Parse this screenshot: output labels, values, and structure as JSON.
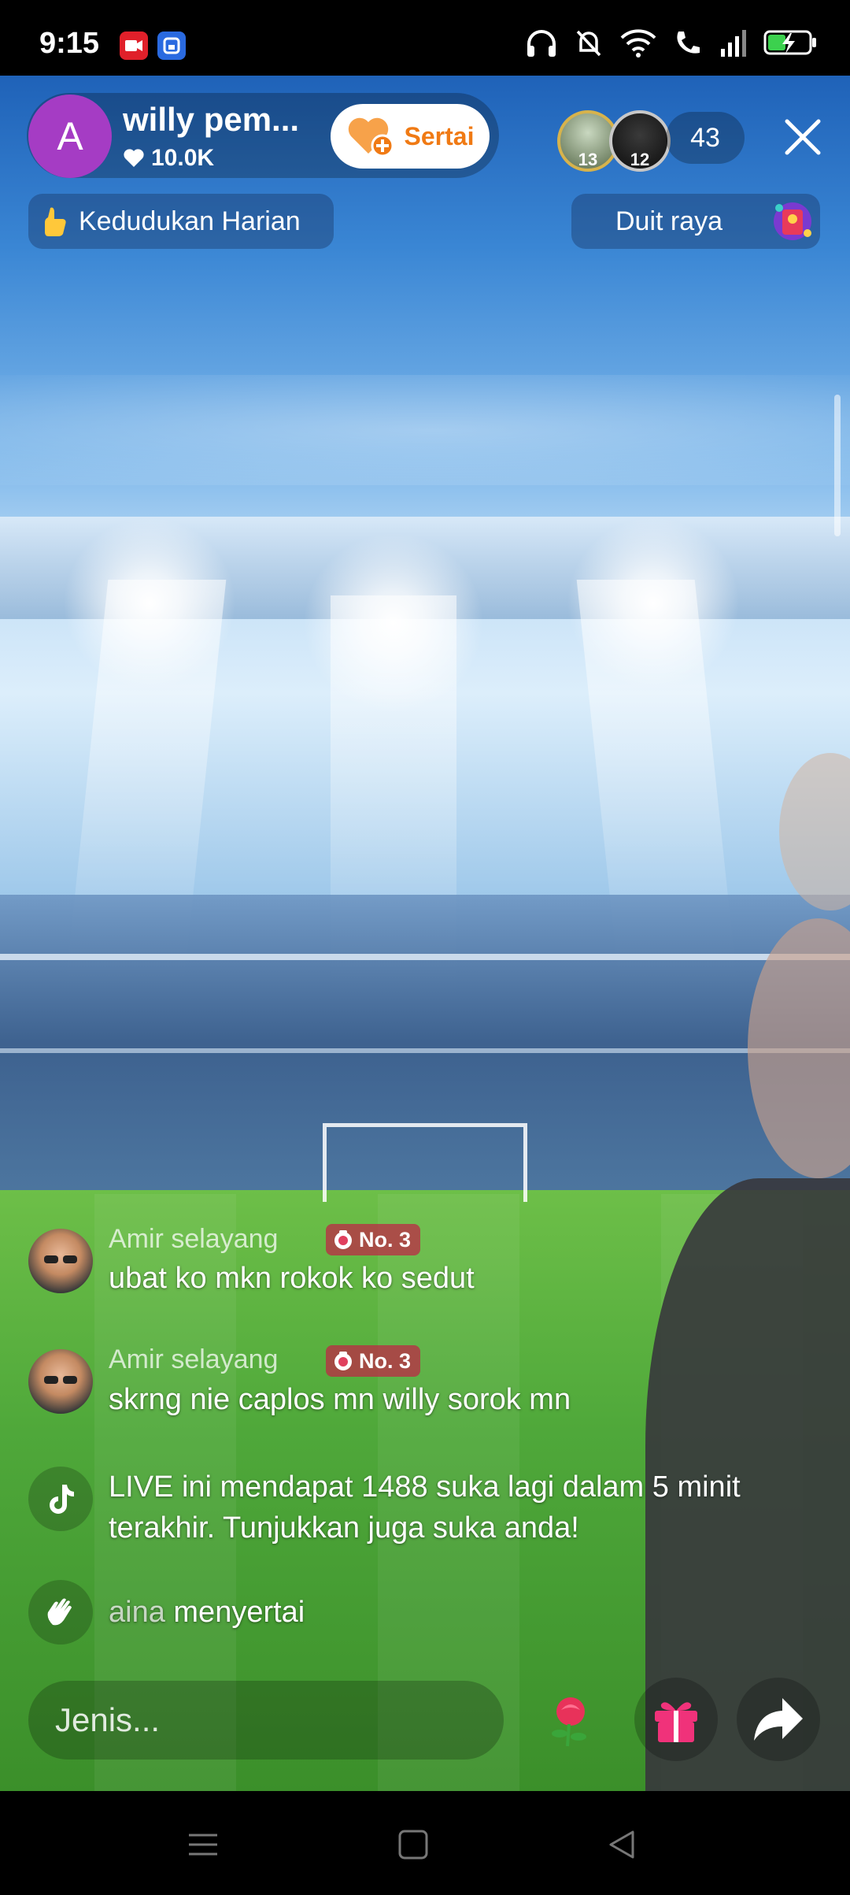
{
  "status_bar": {
    "time": "9:15",
    "left_icons": [
      "screen-recorder-icon",
      "app-notification-icon"
    ],
    "right_icons": [
      "headphones-icon",
      "bell-muted-icon",
      "wifi-icon",
      "wifi-calling-icon",
      "signal-icon",
      "battery-charging-icon"
    ]
  },
  "host": {
    "avatar_letter": "A",
    "name": "willy pem...",
    "likes": "10.0K",
    "follow_label": "Sertai"
  },
  "viewers": {
    "top": [
      {
        "rank": "13"
      },
      {
        "rank": "12"
      }
    ],
    "count": "43"
  },
  "ranking": {
    "label": "Kedudukan Harian"
  },
  "money": {
    "label": "Duit raya"
  },
  "chat": {
    "messages": [
      {
        "user": "Amir selayang",
        "badge": "No. 3",
        "text": "ubat ko mkn rokok ko sedut"
      },
      {
        "user": "Amir selayang",
        "badge": "No. 3",
        "text": "skrng nie caplos mn willy sorok mn"
      }
    ],
    "system_message": "LIVE ini mendapat 1488 suka lagi dalam 5 minit terakhir. Tunjukkan juga suka anda!",
    "join": {
      "user": "aina",
      "action": "menyertai"
    }
  },
  "bottom": {
    "input_placeholder": "Jenis..."
  },
  "colors": {
    "follow_text": "#f07a14",
    "avatar_bg": "#a53cc4",
    "badge_bg": "#be2846",
    "gift_pink": "#f0327a"
  }
}
